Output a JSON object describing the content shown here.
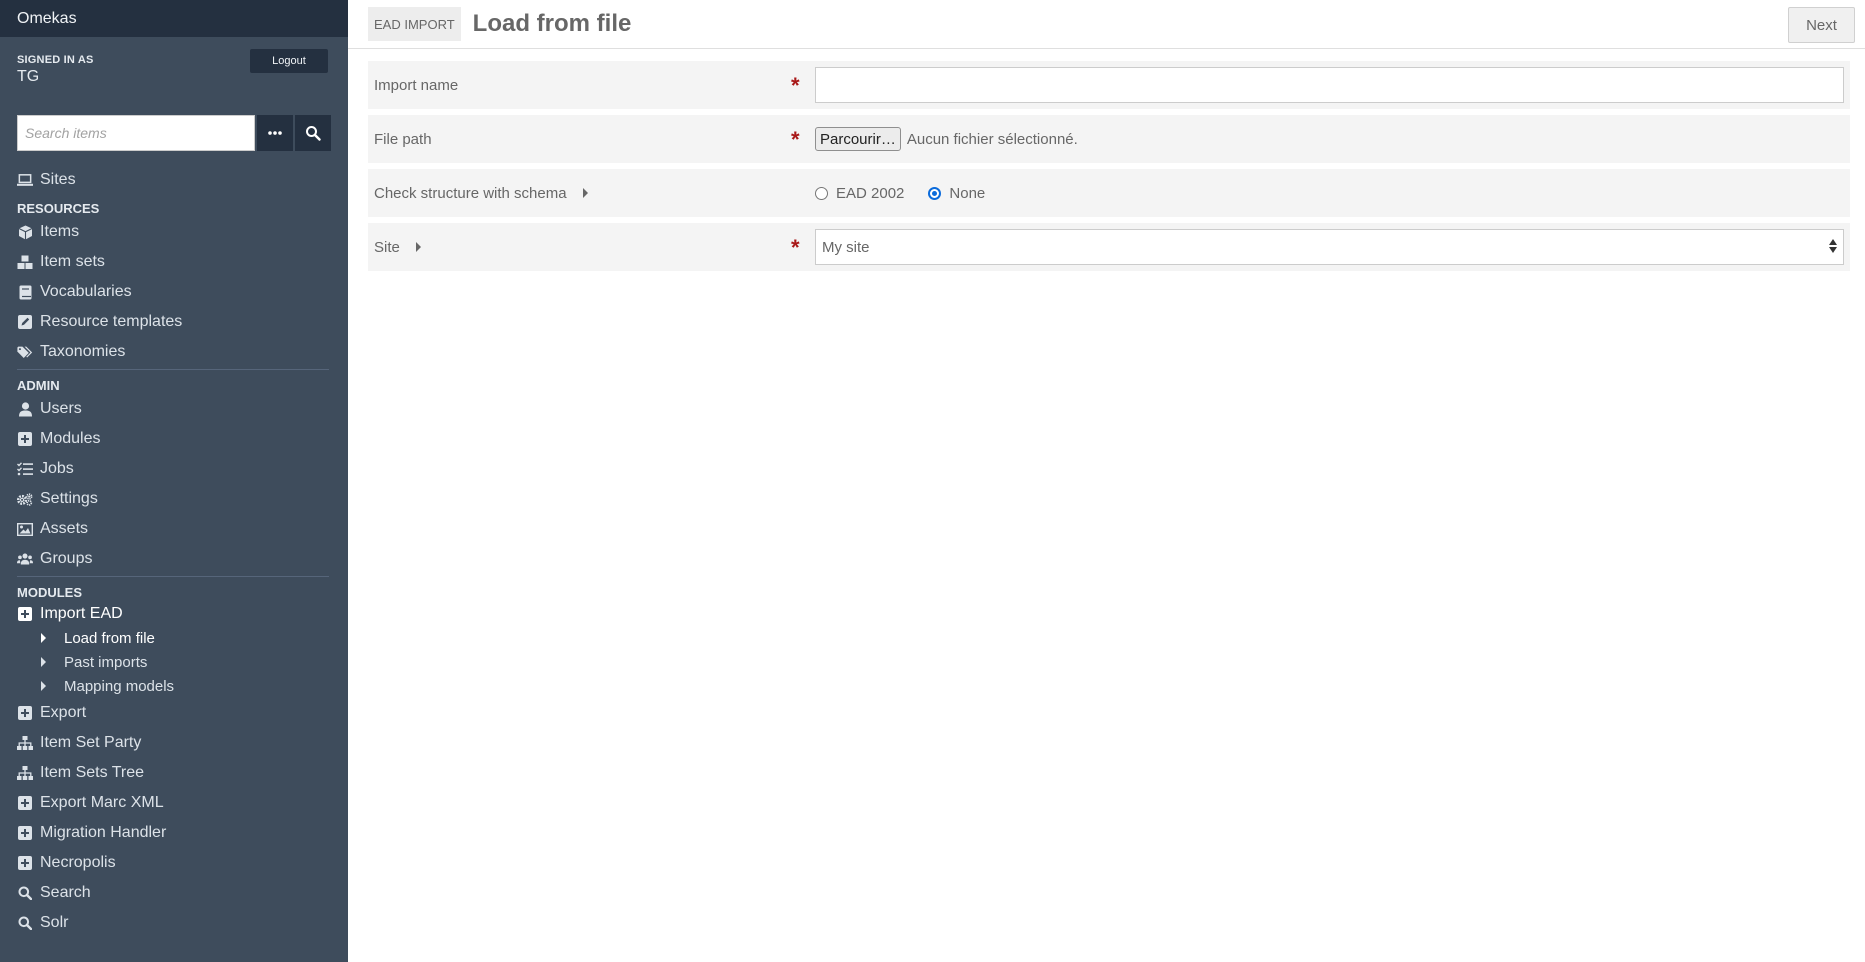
{
  "brand": "Omekas",
  "user": {
    "signed_in_label": "SIGNED IN AS",
    "name": "TG",
    "logout_label": "Logout"
  },
  "search": {
    "placeholder": "Search items",
    "more_icon": "ellipsis-icon",
    "submit_icon": "magnifier-icon"
  },
  "nav": {
    "sites": {
      "label": "Sites",
      "icon": "laptop-icon"
    },
    "resources_heading": "RESOURCES",
    "resources": [
      {
        "label": "Items",
        "icon": "cube-icon"
      },
      {
        "label": "Item sets",
        "icon": "cubes-icon"
      },
      {
        "label": "Vocabularies",
        "icon": "book-icon"
      },
      {
        "label": "Resource templates",
        "icon": "pencil-square-icon"
      },
      {
        "label": "Taxonomies",
        "icon": "tags-icon"
      }
    ],
    "admin_heading": "ADMIN",
    "admin": [
      {
        "label": "Users",
        "icon": "user-icon"
      },
      {
        "label": "Modules",
        "icon": "plus-square-icon"
      },
      {
        "label": "Jobs",
        "icon": "tasks-icon"
      },
      {
        "label": "Settings",
        "icon": "cogs-icon"
      },
      {
        "label": "Assets",
        "icon": "image-icon"
      },
      {
        "label": "Groups",
        "icon": "users-icon"
      }
    ],
    "modules_heading": "MODULES",
    "import_ead": {
      "label": "Import EAD",
      "icon": "plus-square-icon",
      "children": [
        {
          "label": "Load from file"
        },
        {
          "label": "Past imports"
        },
        {
          "label": "Mapping models"
        }
      ]
    },
    "modules": [
      {
        "label": "Export",
        "icon": "plus-square-icon"
      },
      {
        "label": "Item Set Party",
        "icon": "sitemap-icon"
      },
      {
        "label": "Item Sets Tree",
        "icon": "sitemap-icon"
      },
      {
        "label": "Export Marc XML",
        "icon": "plus-square-icon"
      },
      {
        "label": "Migration Handler",
        "icon": "plus-square-icon"
      },
      {
        "label": "Necropolis",
        "icon": "plus-square-icon"
      },
      {
        "label": "Search",
        "icon": "search-icon"
      },
      {
        "label": "Solr",
        "icon": "search-icon"
      }
    ]
  },
  "header": {
    "section": "EAD IMPORT",
    "title": "Load from file",
    "next_label": "Next"
  },
  "form": {
    "import_name": {
      "label": "Import name",
      "value": ""
    },
    "file_path": {
      "label": "File path",
      "button_label": "Parcourir…",
      "status": "Aucun fichier sélectionné."
    },
    "schema": {
      "label": "Check structure with schema",
      "options": [
        "EAD 2002",
        "None"
      ],
      "selected": "None"
    },
    "site": {
      "label": "Site",
      "selected": "My site"
    }
  },
  "colors": {
    "sidebar": "#3e4c5c",
    "sidebar_dark": "#243040",
    "required": "#a91919",
    "radio_accent": "#0b6bdb"
  }
}
